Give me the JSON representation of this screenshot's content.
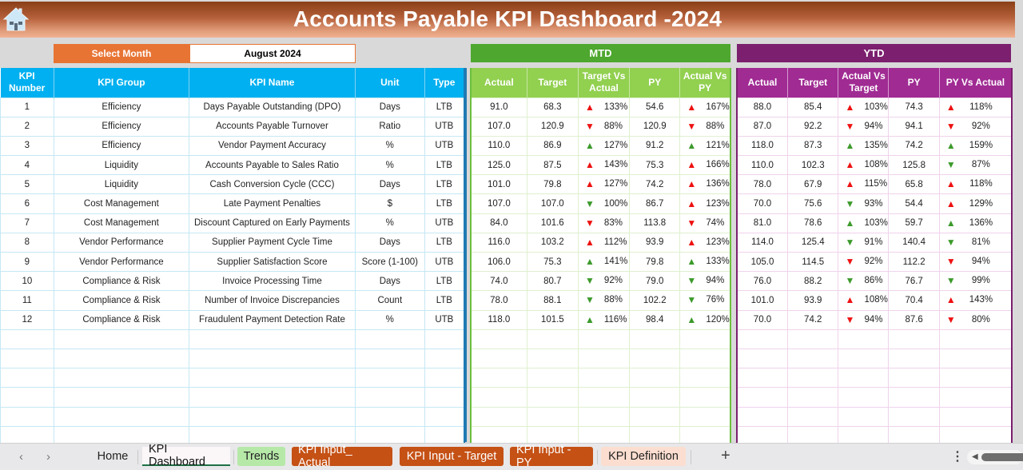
{
  "header": {
    "title": "Accounts Payable KPI Dashboard  -2024",
    "home_icon": "home-icon"
  },
  "selector": {
    "label": "Select Month",
    "value": "August 2024"
  },
  "bands": {
    "mtd": "MTD",
    "ytd": "YTD"
  },
  "columns": {
    "left": [
      "KPI Number",
      "KPI Group",
      "KPI Name",
      "Unit",
      "Type"
    ],
    "mtd": [
      "Actual",
      "Target",
      "Target Vs Actual",
      "PY",
      "Actual Vs PY"
    ],
    "ytd": [
      "Actual",
      "Target",
      "Actual Vs Target",
      "PY",
      "PY Vs Actual"
    ]
  },
  "indicator_colors": {
    "red": "#ee1111",
    "green": "#3c9a2b"
  },
  "rows": [
    {
      "num": "1",
      "group": "Efficiency",
      "name": "Days Payable Outstanding (DPO)",
      "unit": "Days",
      "type": "LTB",
      "mtd": {
        "actual": "91.0",
        "target": "68.3",
        "tva": {
          "dir": "up",
          "color": "red",
          "pct": "133%"
        },
        "py": "54.6",
        "avp": {
          "dir": "up",
          "color": "red",
          "pct": "167%"
        }
      },
      "ytd": {
        "actual": "88.0",
        "target": "85.4",
        "avt": {
          "dir": "up",
          "color": "red",
          "pct": "103%"
        },
        "py": "74.3",
        "pva": {
          "dir": "up",
          "color": "red",
          "pct": "118%"
        }
      }
    },
    {
      "num": "2",
      "group": "Efficiency",
      "name": "Accounts Payable Turnover",
      "unit": "Ratio",
      "type": "UTB",
      "mtd": {
        "actual": "107.0",
        "target": "120.9",
        "tva": {
          "dir": "down",
          "color": "red",
          "pct": "88%"
        },
        "py": "120.9",
        "avp": {
          "dir": "down",
          "color": "red",
          "pct": "88%"
        }
      },
      "ytd": {
        "actual": "87.0",
        "target": "92.2",
        "avt": {
          "dir": "down",
          "color": "red",
          "pct": "94%"
        },
        "py": "94.1",
        "pva": {
          "dir": "down",
          "color": "red",
          "pct": "92%"
        }
      }
    },
    {
      "num": "3",
      "group": "Efficiency",
      "name": "Vendor Payment Accuracy",
      "unit": "%",
      "type": "UTB",
      "mtd": {
        "actual": "110.0",
        "target": "86.9",
        "tva": {
          "dir": "up",
          "color": "green",
          "pct": "127%"
        },
        "py": "91.2",
        "avp": {
          "dir": "up",
          "color": "green",
          "pct": "121%"
        }
      },
      "ytd": {
        "actual": "118.0",
        "target": "87.3",
        "avt": {
          "dir": "up",
          "color": "green",
          "pct": "135%"
        },
        "py": "74.2",
        "pva": {
          "dir": "up",
          "color": "green",
          "pct": "159%"
        }
      }
    },
    {
      "num": "4",
      "group": "Liquidity",
      "name": "Accounts Payable to Sales Ratio",
      "unit": "%",
      "type": "LTB",
      "mtd": {
        "actual": "125.0",
        "target": "87.5",
        "tva": {
          "dir": "up",
          "color": "red",
          "pct": "143%"
        },
        "py": "75.3",
        "avp": {
          "dir": "up",
          "color": "red",
          "pct": "166%"
        }
      },
      "ytd": {
        "actual": "110.0",
        "target": "102.3",
        "avt": {
          "dir": "up",
          "color": "red",
          "pct": "108%"
        },
        "py": "125.8",
        "pva": {
          "dir": "down",
          "color": "green",
          "pct": "87%"
        }
      }
    },
    {
      "num": "5",
      "group": "Liquidity",
      "name": "Cash Conversion Cycle (CCC)",
      "unit": "Days",
      "type": "LTB",
      "mtd": {
        "actual": "101.0",
        "target": "79.8",
        "tva": {
          "dir": "up",
          "color": "red",
          "pct": "127%"
        },
        "py": "74.2",
        "avp": {
          "dir": "up",
          "color": "red",
          "pct": "136%"
        }
      },
      "ytd": {
        "actual": "78.0",
        "target": "67.9",
        "avt": {
          "dir": "up",
          "color": "red",
          "pct": "115%"
        },
        "py": "65.8",
        "pva": {
          "dir": "up",
          "color": "red",
          "pct": "118%"
        }
      }
    },
    {
      "num": "6",
      "group": "Cost Management",
      "name": "Late Payment Penalties",
      "unit": "$",
      "type": "LTB",
      "mtd": {
        "actual": "107.0",
        "target": "107.0",
        "tva": {
          "dir": "down",
          "color": "green",
          "pct": "100%"
        },
        "py": "86.7",
        "avp": {
          "dir": "up",
          "color": "red",
          "pct": "123%"
        }
      },
      "ytd": {
        "actual": "70.0",
        "target": "75.6",
        "avt": {
          "dir": "down",
          "color": "green",
          "pct": "93%"
        },
        "py": "54.4",
        "pva": {
          "dir": "up",
          "color": "red",
          "pct": "129%"
        }
      }
    },
    {
      "num": "7",
      "group": "Cost Management",
      "name": "Discount Captured on Early Payments",
      "unit": "%",
      "type": "UTB",
      "mtd": {
        "actual": "84.0",
        "target": "101.6",
        "tva": {
          "dir": "down",
          "color": "red",
          "pct": "83%"
        },
        "py": "113.8",
        "avp": {
          "dir": "down",
          "color": "red",
          "pct": "74%"
        }
      },
      "ytd": {
        "actual": "81.0",
        "target": "78.6",
        "avt": {
          "dir": "up",
          "color": "green",
          "pct": "103%"
        },
        "py": "59.7",
        "pva": {
          "dir": "up",
          "color": "green",
          "pct": "136%"
        }
      }
    },
    {
      "num": "8",
      "group": "Vendor Performance",
      "name": "Supplier Payment Cycle Time",
      "unit": "Days",
      "type": "LTB",
      "mtd": {
        "actual": "116.0",
        "target": "103.2",
        "tva": {
          "dir": "up",
          "color": "red",
          "pct": "112%"
        },
        "py": "93.9",
        "avp": {
          "dir": "up",
          "color": "red",
          "pct": "123%"
        }
      },
      "ytd": {
        "actual": "114.0",
        "target": "125.4",
        "avt": {
          "dir": "down",
          "color": "green",
          "pct": "91%"
        },
        "py": "140.4",
        "pva": {
          "dir": "down",
          "color": "green",
          "pct": "81%"
        }
      }
    },
    {
      "num": "9",
      "group": "Vendor Performance",
      "name": "Supplier Satisfaction Score",
      "unit": "Score (1-100)",
      "type": "UTB",
      "mtd": {
        "actual": "106.0",
        "target": "75.3",
        "tva": {
          "dir": "up",
          "color": "green",
          "pct": "141%"
        },
        "py": "79.8",
        "avp": {
          "dir": "up",
          "color": "green",
          "pct": "133%"
        }
      },
      "ytd": {
        "actual": "105.0",
        "target": "114.5",
        "avt": {
          "dir": "down",
          "color": "red",
          "pct": "92%"
        },
        "py": "112.2",
        "pva": {
          "dir": "down",
          "color": "red",
          "pct": "94%"
        }
      }
    },
    {
      "num": "10",
      "group": "Compliance & Risk",
      "name": "Invoice Processing Time",
      "unit": "Days",
      "type": "LTB",
      "mtd": {
        "actual": "74.0",
        "target": "80.7",
        "tva": {
          "dir": "down",
          "color": "green",
          "pct": "92%"
        },
        "py": "79.0",
        "avp": {
          "dir": "down",
          "color": "green",
          "pct": "94%"
        }
      },
      "ytd": {
        "actual": "76.0",
        "target": "88.2",
        "avt": {
          "dir": "down",
          "color": "green",
          "pct": "86%"
        },
        "py": "76.7",
        "pva": {
          "dir": "down",
          "color": "green",
          "pct": "99%"
        }
      }
    },
    {
      "num": "11",
      "group": "Compliance & Risk",
      "name": "Number of Invoice Discrepancies",
      "unit": "Count",
      "type": "LTB",
      "mtd": {
        "actual": "78.0",
        "target": "88.1",
        "tva": {
          "dir": "down",
          "color": "green",
          "pct": "88%"
        },
        "py": "102.2",
        "avp": {
          "dir": "down",
          "color": "green",
          "pct": "76%"
        }
      },
      "ytd": {
        "actual": "101.0",
        "target": "93.9",
        "avt": {
          "dir": "up",
          "color": "red",
          "pct": "108%"
        },
        "py": "70.4",
        "pva": {
          "dir": "up",
          "color": "red",
          "pct": "143%"
        }
      }
    },
    {
      "num": "12",
      "group": "Compliance & Risk",
      "name": "Fraudulent Payment Detection Rate",
      "unit": "%",
      "type": "UTB",
      "mtd": {
        "actual": "118.0",
        "target": "101.5",
        "tva": {
          "dir": "up",
          "color": "green",
          "pct": "116%"
        },
        "py": "98.4",
        "avp": {
          "dir": "up",
          "color": "green",
          "pct": "120%"
        }
      },
      "ytd": {
        "actual": "70.0",
        "target": "74.2",
        "avt": {
          "dir": "down",
          "color": "red",
          "pct": "94%"
        },
        "py": "87.6",
        "pva": {
          "dir": "down",
          "color": "red",
          "pct": "80%"
        }
      }
    }
  ],
  "empty_rows": 6,
  "sheet_tabs": {
    "nav_prev": "‹",
    "nav_next": "›",
    "items": [
      "Home",
      "KPI Dashboard",
      "Trends",
      "KPI Input_ Actual",
      "KPI Input - Target",
      "KPI Input - PY",
      "KPI Definition"
    ],
    "active": "KPI Dashboard",
    "add": "+",
    "more": "⋮"
  }
}
